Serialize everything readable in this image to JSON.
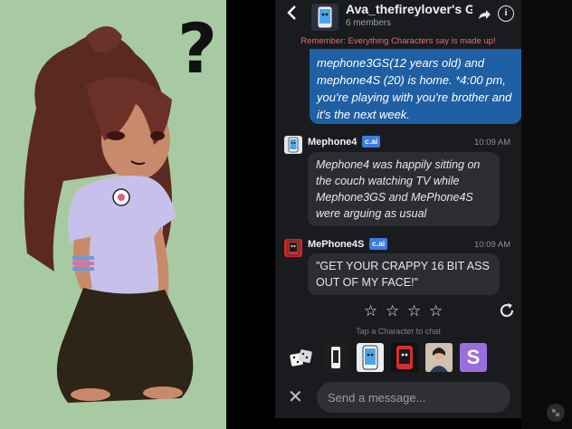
{
  "art": {
    "question_mark": "?"
  },
  "header": {
    "back_icon": "chevron-left-icon",
    "title": "Ava_thefireylover's Grc",
    "members": "6 members",
    "share_icon": "share-icon",
    "info_icon": "info-icon",
    "info_glyph": "i"
  },
  "disclaimer": "Remember: Everything Characters say is made up!",
  "messages": [
    {
      "type": "user",
      "text": "mephone3GS(12 years old) and mephone4S (20) is home. *4:00 pm, you're playing with you're brother and it's the next week."
    },
    {
      "type": "bot",
      "name": "Mephone4",
      "badge": "c.ai",
      "time": "10:09 AM",
      "text": "Mephone4 was happily sitting on the couch watching TV while Mephone3GS and MePhone4S were arguing as usual"
    },
    {
      "type": "bot",
      "name": "MePhone4S",
      "badge": "c.ai",
      "time": "10:09 AM",
      "text": "\"GET YOUR CRAPPY 16 BIT ASS OUT OF MY FACE!\""
    }
  ],
  "rating": {
    "stars": 4,
    "star_glyph": "☆",
    "refresh_icon": "refresh-icon"
  },
  "tap_hint": "Tap a Character to chat",
  "characters": [
    {
      "name": "dice-icon"
    },
    {
      "name": "mephone3gs-avatar"
    },
    {
      "name": "mephone4-avatar"
    },
    {
      "name": "mephone4s-avatar"
    },
    {
      "name": "human-character-avatar"
    },
    {
      "name": "s-avatar",
      "letter": "S"
    }
  ],
  "input": {
    "close_glyph": "✕",
    "placeholder": "Send a message..."
  },
  "colors": {
    "art_bg": "#a8caa3",
    "chat_bg": "#1a1b1f",
    "user_bubble": "#1f5fa3",
    "bot_bubble": "#2c2d33",
    "badge": "#3b7de0",
    "disclaimer": "#e07070"
  }
}
